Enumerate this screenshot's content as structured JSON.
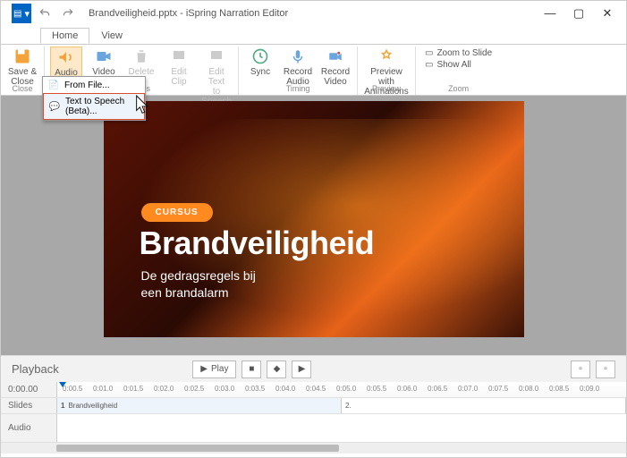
{
  "window": {
    "title": "Brandveiligheid.pptx - iSpring Narration Editor",
    "min": "—",
    "max": "▢",
    "close": "✕"
  },
  "file_menu_glyph": "▾",
  "tabs": {
    "home": "Home",
    "view": "View"
  },
  "ribbon": {
    "save_close": "Save &\nClose",
    "audio": "Audio",
    "video": "Video",
    "delete": "Delete",
    "edit_clip": "Edit\nClip",
    "edit_tts": "Edit Text\nto Speech",
    "sync": "Sync",
    "record_audio": "Record\nAudio",
    "record_video": "Record\nVideo",
    "preview": "Preview with\nAnimations",
    "zoom_slide": "Zoom to Slide",
    "show_all": "Show All",
    "group_close": "Close",
    "group_clips": "Clips",
    "group_timing": "Timing",
    "group_preview": "Preview",
    "group_zoom": "Zoom"
  },
  "dropdown": {
    "from_file": "From File...",
    "tts": "Text to Speech (Beta)..."
  },
  "slide": {
    "badge": "CURSUS",
    "title": "Brandveiligheid",
    "sub1": "De gedragsregels bij",
    "sub2": "een brandalarm"
  },
  "playback": {
    "label": "Playback",
    "play": "Play"
  },
  "timeline": {
    "start": "0:00.00",
    "ticks": [
      "0:00.5",
      "0:01.0",
      "0:01.5",
      "0:02.0",
      "0:02.5",
      "0:03.0",
      "0:03.5",
      "0:04.0",
      "0:04.5",
      "0:05.0",
      "0:05.5",
      "0:06.0",
      "0:06.5",
      "0:07.0",
      "0:07.5",
      "0:08.0",
      "0:08.5",
      "0:09.0"
    ],
    "row_slides": "Slides",
    "row_audio": "Audio",
    "clip1_num": "1",
    "clip1_name": "Brandveiligheid",
    "clip2_num": "2."
  }
}
